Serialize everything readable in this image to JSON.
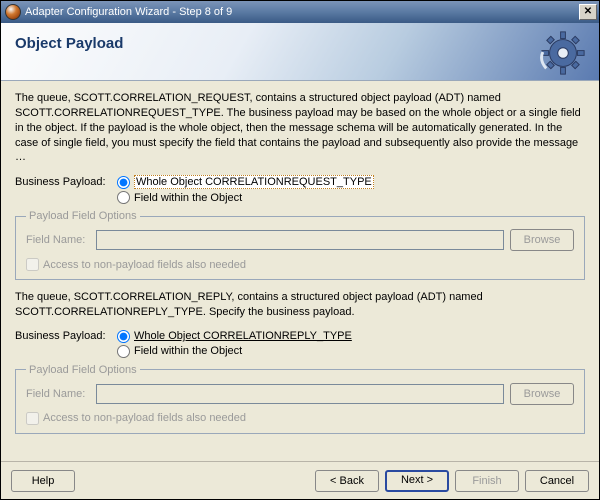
{
  "window": {
    "title": "Adapter Configuration Wizard - Step 8 of 9",
    "close_glyph": "✕"
  },
  "header": {
    "title": "Object Payload"
  },
  "section1": {
    "description": "The queue, SCOTT.CORRELATION_REQUEST, contains a structured object payload (ADT) named SCOTT.CORRELATIONREQUEST_TYPE.  The business payload may be based on the whole object or a single field in the object. If the payload is the whole object, then the message schema will be automatically generated. In the case of single field, you must specify the field that contains the payload and subsequently also provide the message …",
    "bp_label": "Business Payload:",
    "radio_whole": "Whole Object CORRELATIONREQUEST_TYPE",
    "radio_field": "Field within the Object",
    "fieldset_legend": "Payload Field Options",
    "field_name_label": "Field Name:",
    "browse": "Browse",
    "access_chk": "Access to non-payload fields also needed"
  },
  "section2": {
    "description": "The queue, SCOTT.CORRELATION_REPLY, contains a structured object payload (ADT) named SCOTT.CORRELATIONREPLY_TYPE.  Specify the business payload.",
    "bp_label": "Business Payload:",
    "radio_whole": "Whole Object CORRELATIONREPLY_TYPE",
    "radio_field": "Field within the Object",
    "fieldset_legend": "Payload Field Options",
    "field_name_label": "Field Name:",
    "browse": "Browse",
    "access_chk": "Access to non-payload fields also needed"
  },
  "footer": {
    "help": "Help",
    "back": "< Back",
    "next": "Next >",
    "finish": "Finish",
    "cancel": "Cancel"
  }
}
